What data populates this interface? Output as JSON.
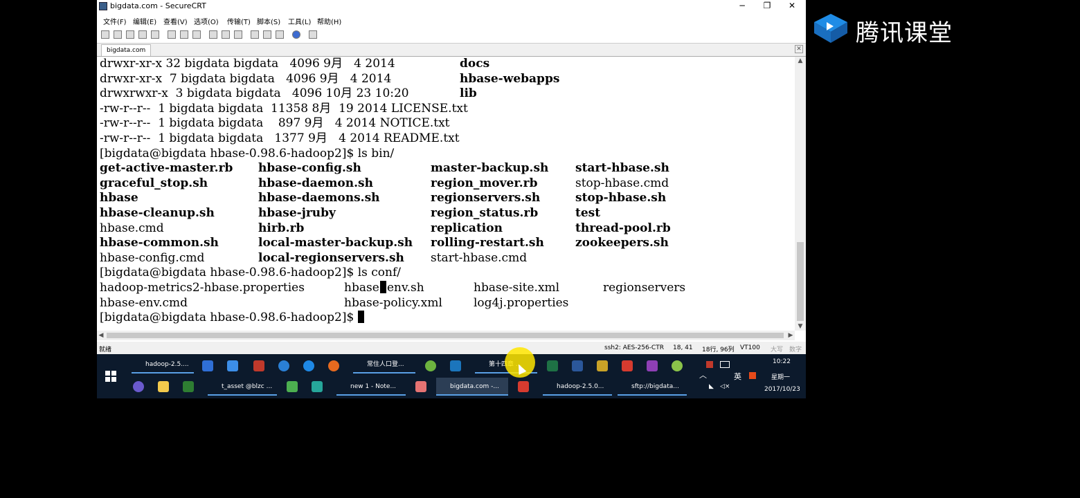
{
  "window": {
    "title": "bigdata.com - SecureCRT"
  },
  "window_controls": {
    "minimize": "−",
    "restore": "❐",
    "close": "✕"
  },
  "menu": [
    "文件(F)",
    "编辑(E)",
    "查看(V)",
    "选项(O)",
    "传输(T)",
    "脚本(S)",
    "工具(L)",
    "帮助(H)"
  ],
  "tab": {
    "label": "bigdata.com",
    "close": "✕"
  },
  "terminal": {
    "lines": [
      [
        {
          "t": "drwxr-xr-x 32 bigdata bigdata   4096 9月   4 2014 ",
          "b": false
        },
        {
          "t": "docs",
          "b": true
        }
      ],
      [
        {
          "t": "drwxr-xr-x  7 bigdata bigdata   4096 9月   4 2014 ",
          "b": false
        },
        {
          "t": "hbase-webapps",
          "b": true
        }
      ],
      [
        {
          "t": "drwxrwxr-x  3 bigdata bigdata   4096 10月 23 10:20 ",
          "b": false
        },
        {
          "t": "lib",
          "b": true
        }
      ],
      [
        {
          "t": "-rw-r--r--  1 bigdata bigdata  11358 8月  19 2014 LICENSE.txt",
          "b": false
        }
      ],
      [
        {
          "t": "-rw-r--r--  1 bigdata bigdata    897 9月   4 2014 NOTICE.txt",
          "b": false
        }
      ],
      [
        {
          "t": "-rw-r--r--  1 bigdata bigdata   1377 9月   4 2014 README.txt",
          "b": false
        }
      ],
      [
        {
          "t": "[bigdata@bigdata hbase-0.98.6-hadoop2]$ ls bin/",
          "b": false
        }
      ]
    ],
    "bin_columns": [
      [
        {
          "t": "get-active-master.rb",
          "b": true
        },
        {
          "t": "graceful_stop.sh",
          "b": true
        },
        {
          "t": "hbase",
          "b": true
        },
        {
          "t": "hbase-cleanup.sh",
          "b": true
        },
        {
          "t": "hbase.cmd",
          "b": false
        },
        {
          "t": "hbase-common.sh",
          "b": true
        },
        {
          "t": "hbase-config.cmd",
          "b": false
        }
      ],
      [
        {
          "t": "hbase-config.sh",
          "b": true
        },
        {
          "t": "hbase-daemon.sh",
          "b": true
        },
        {
          "t": "hbase-daemons.sh",
          "b": true
        },
        {
          "t": "hbase-jruby",
          "b": true
        },
        {
          "t": "hirb.rb",
          "b": true
        },
        {
          "t": "local-master-backup.sh",
          "b": true
        },
        {
          "t": "local-regionservers.sh",
          "b": true
        }
      ],
      [
        {
          "t": "master-backup.sh",
          "b": true
        },
        {
          "t": "region_mover.rb",
          "b": true
        },
        {
          "t": "regionservers.sh",
          "b": true
        },
        {
          "t": "region_status.rb",
          "b": true
        },
        {
          "t": "replication",
          "b": true
        },
        {
          "t": "rolling-restart.sh",
          "b": true
        },
        {
          "t": "start-hbase.cmd",
          "b": false
        }
      ],
      [
        {
          "t": "start-hbase.sh",
          "b": true
        },
        {
          "t": "stop-hbase.cmd",
          "b": false
        },
        {
          "t": "stop-hbase.sh",
          "b": true
        },
        {
          "t": "test",
          "b": true
        },
        {
          "t": "thread-pool.rb",
          "b": true
        },
        {
          "t": "zookeepers.sh",
          "b": true
        },
        {
          "t": "",
          "b": false
        }
      ]
    ],
    "ls_conf_cmd": "[bigdata@bigdata hbase-0.98.6-hadoop2]$ ls conf/",
    "conf_row1": [
      "hadoop-metrics2-hbase.properties",
      "hbase",
      "env.sh",
      "hbase-site.xml",
      "regionservers"
    ],
    "conf_row2": [
      "hbase-env.cmd",
      "hbase-policy.xml",
      "log4j.properties"
    ],
    "prompt": "[bigdata@bigdata hbase-0.98.6-hadoop2]$ "
  },
  "status": {
    "left": "就绪",
    "cipher": "ssh2: AES-256-CTR",
    "pos": "18,  41",
    "size": "18行, 96列",
    "emu": "VT100",
    "caps": "大写",
    "num": "数字"
  },
  "taskbar": {
    "row1": [
      {
        "label": "hadoop-2.5....",
        "color": "#f2c94c"
      },
      {
        "label": "常住人口登...",
        "color": "#e8e8e8"
      },
      {
        "label": "第十四章 ...",
        "color": "#d35230"
      }
    ],
    "row2": [
      {
        "label": "t_asset @blzc ...",
        "color": "#f2c94c"
      },
      {
        "label": "new  1 - Note...",
        "color": "#8bc34a"
      },
      {
        "label": "bigdata.com -...",
        "color": "#5a7fa8"
      },
      {
        "label": "hadoop-2.5.0...",
        "color": "#3b8fd8"
      },
      {
        "label": "sftp://bigdata...",
        "color": "#d63b2f"
      }
    ]
  },
  "tray": {
    "ime": "英",
    "time": "10:22",
    "weekday": "星期一",
    "date": "2017/10/23"
  },
  "brand": {
    "text": "腾讯课堂"
  }
}
